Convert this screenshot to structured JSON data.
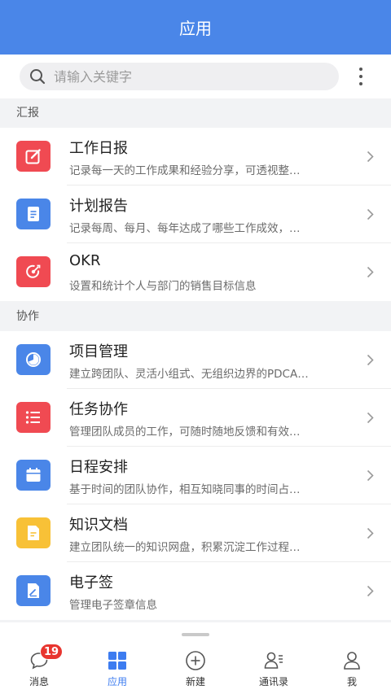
{
  "header": {
    "title": "应用"
  },
  "search": {
    "placeholder": "请输入关键字",
    "value": ""
  },
  "sections": [
    {
      "label": "汇报",
      "items": [
        {
          "title": "工作日报",
          "desc": "记录每一天的工作成果和经验分享，可透视整…",
          "icon": "edit-icon",
          "color": "#f04a52"
        },
        {
          "title": "计划报告",
          "desc": "记录每周、每月、每年达成了哪些工作成效，…",
          "icon": "document-icon",
          "color": "#4a86e8"
        },
        {
          "title": "OKR",
          "desc": "设置和统计个人与部门的销售目标信息",
          "icon": "target-icon",
          "color": "#f04a52"
        }
      ]
    },
    {
      "label": "协作",
      "items": [
        {
          "title": "项目管理",
          "desc": "建立跨团队、灵活小组式、无组织边界的PDCA…",
          "icon": "pie-chart-icon",
          "color": "#4a86e8"
        },
        {
          "title": "任务协作",
          "desc": "管理团队成员的工作，可随时随地反馈和有效…",
          "icon": "list-icon",
          "color": "#f04a52"
        },
        {
          "title": "日程安排",
          "desc": "基于时间的团队协作，相互知晓同事的时间占…",
          "icon": "calendar-icon",
          "color": "#4a86e8"
        },
        {
          "title": "知识文档",
          "desc": "建立团队统一的知识网盘，积累沉淀工作过程…",
          "icon": "file-icon",
          "color": "#f8c137"
        },
        {
          "title": "电子签",
          "desc": "管理电子签章信息",
          "icon": "signature-icon",
          "color": "#4a86e8"
        }
      ]
    }
  ],
  "tabbar": {
    "tabs": [
      {
        "label": "消息",
        "icon": "message-icon",
        "badge": "19"
      },
      {
        "label": "应用",
        "icon": "apps-icon",
        "active": true
      },
      {
        "label": "新建",
        "icon": "plus-circle-icon"
      },
      {
        "label": "通讯录",
        "icon": "contacts-icon"
      },
      {
        "label": "我",
        "icon": "person-icon"
      }
    ]
  },
  "colors": {
    "accent": "#4a86e8",
    "active_tab": "#3d7cf0",
    "badge": "#e8352f"
  }
}
